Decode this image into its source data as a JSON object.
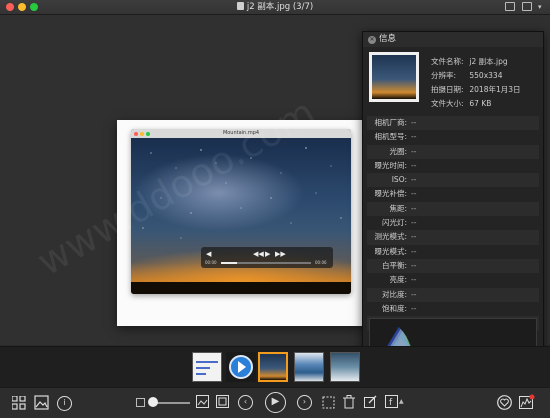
{
  "window": {
    "title": "j2 副本.jpg (3/7)"
  },
  "photo": {
    "inner_window_title": "Mountain.mp4",
    "video_time_left": "00:00",
    "video_time_right": "00:06"
  },
  "info": {
    "header": "信息",
    "meta": [
      {
        "key": "文件名称:",
        "value": "j2 副本.jpg"
      },
      {
        "key": "分辨率:",
        "value": "550x334"
      },
      {
        "key": "拍摄日期:",
        "value": "2018年1月3日"
      },
      {
        "key": "文件大小:",
        "value": "67 KB"
      }
    ],
    "exif": [
      {
        "key": "相机厂商:",
        "value": "--"
      },
      {
        "key": "相机型号:",
        "value": "--"
      },
      {
        "key": "光圈:",
        "value": "--"
      },
      {
        "key": "曝光时间:",
        "value": "--"
      },
      {
        "key": "ISO:",
        "value": "--"
      },
      {
        "key": "曝光补偿:",
        "value": "--"
      },
      {
        "key": "焦距:",
        "value": "--"
      },
      {
        "key": "闪光灯:",
        "value": "--"
      },
      {
        "key": "测光模式:",
        "value": "--"
      },
      {
        "key": "曝光模式:",
        "value": "--"
      },
      {
        "key": "白平衡:",
        "value": "--"
      },
      {
        "key": "亮度:",
        "value": "--"
      },
      {
        "key": "对比度:",
        "value": "--"
      },
      {
        "key": "饱和度:",
        "value": "--"
      },
      {
        "key": "镜头:",
        "value": "--"
      }
    ]
  },
  "watermark": "www.ddooo.com",
  "colors": {
    "accent": "#f29b1d",
    "close": "#fc5f57",
    "minimize": "#fdbc2e",
    "maximize": "#28c840"
  }
}
